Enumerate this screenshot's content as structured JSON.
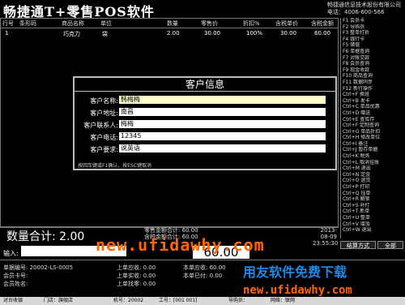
{
  "app": {
    "title": "畅捷通T+零售POS软件"
  },
  "company": {
    "name": "畅捷通信息技术股份有限公司",
    "phone": "电话：4006-600-566"
  },
  "table": {
    "columns": [
      "行号",
      "条形码",
      "商品名称",
      "单位",
      "数量",
      "零售价",
      "折扣%",
      "含税单价",
      "含税金额"
    ],
    "rows": [
      [
        "1",
        "",
        "巧克力",
        "袋",
        "2.00",
        "30.00",
        "100%",
        "30.00",
        "60.00"
      ]
    ]
  },
  "shortcuts": [
    "F1 会员卡",
    "F2 导购员",
    "F3 整单打折",
    "F4 银行卡",
    "F5 储值",
    "F6 单据查询",
    "F7 对账交款",
    "F8 会员查询",
    "F9 现金收款",
    "F10 商品查询",
    "F11 数据同步",
    "F12 新行操作",
    "Ctrl+F 换班",
    "Ctrl+B 发卡",
    "Ctrl+C 单品优惠",
    "Ctrl+D 赠送",
    "Ctrl+E 查库存",
    "Ctrl+F 定制查询",
    "Ctrl+G 单品折扣",
    "Ctrl+H 修改单位",
    "Ctrl+I 备注",
    "Ctrl+J 暂存单据",
    "Ctrl+K 税务",
    "Ctrl+L 取消挂账",
    "Ctrl+M 退出",
    "Ctrl+N 定金",
    "Ctrl+O 退货",
    "Ctrl+P 打印",
    "Ctrl+Q 挂单",
    "Ctrl+R 解锁",
    "Ctrl+S 补打",
    "Ctrl+T 新单",
    "Ctrl+U 整单",
    "Ctrl+V 增加",
    "Ctrl+W 退出"
  ],
  "dialog": {
    "title": "客户信息",
    "fields": [
      {
        "label": "客户名称:",
        "value": "韩梅梅"
      },
      {
        "label": "客户地址:",
        "value": "南昌"
      },
      {
        "label": "客户联系人:",
        "value": "梅梅"
      },
      {
        "label": "客户电话:",
        "value": "12345"
      },
      {
        "label": "客户要求:",
        "value": "说英语"
      }
    ],
    "hint": "按回车键或F1确认，按ESC键取消"
  },
  "summary": {
    "qty_label": "数量合计:",
    "qty_value": "2.00",
    "retail_total": "零售金额合计: 60.00",
    "tax_total": "含税金额合计: 60.00",
    "date": "2013-08-09",
    "time": "23:55:30"
  },
  "input": {
    "label": "输入:",
    "value": ""
  },
  "amount": "60.00",
  "buttons": {
    "settle": "结算方式",
    "all": "全部"
  },
  "bottom": {
    "doc_no": "单据编号:        20002-LS-0005",
    "member_card": "会员卡号:",
    "member_name": "会员姓名:",
    "prev_due": "上单应收:        0.00",
    "prev_paid": "上单实收:        0.00",
    "prev_change": "上单找零:        0.00",
    "cur_due": "本单应收:        60.00",
    "cur_paid": "本单已付:        0.00"
  },
  "status": [
    "对台收银",
    "门店：旗舰店",
    "机号：20002",
    "工号：[001 001]",
    "导购员：",
    "网络：联网"
  ],
  "watermark": {
    "url1": "new.ufidawhy.com",
    "brand": "用友软件免费下载",
    "url2": "new.ufidawhy.com"
  }
}
